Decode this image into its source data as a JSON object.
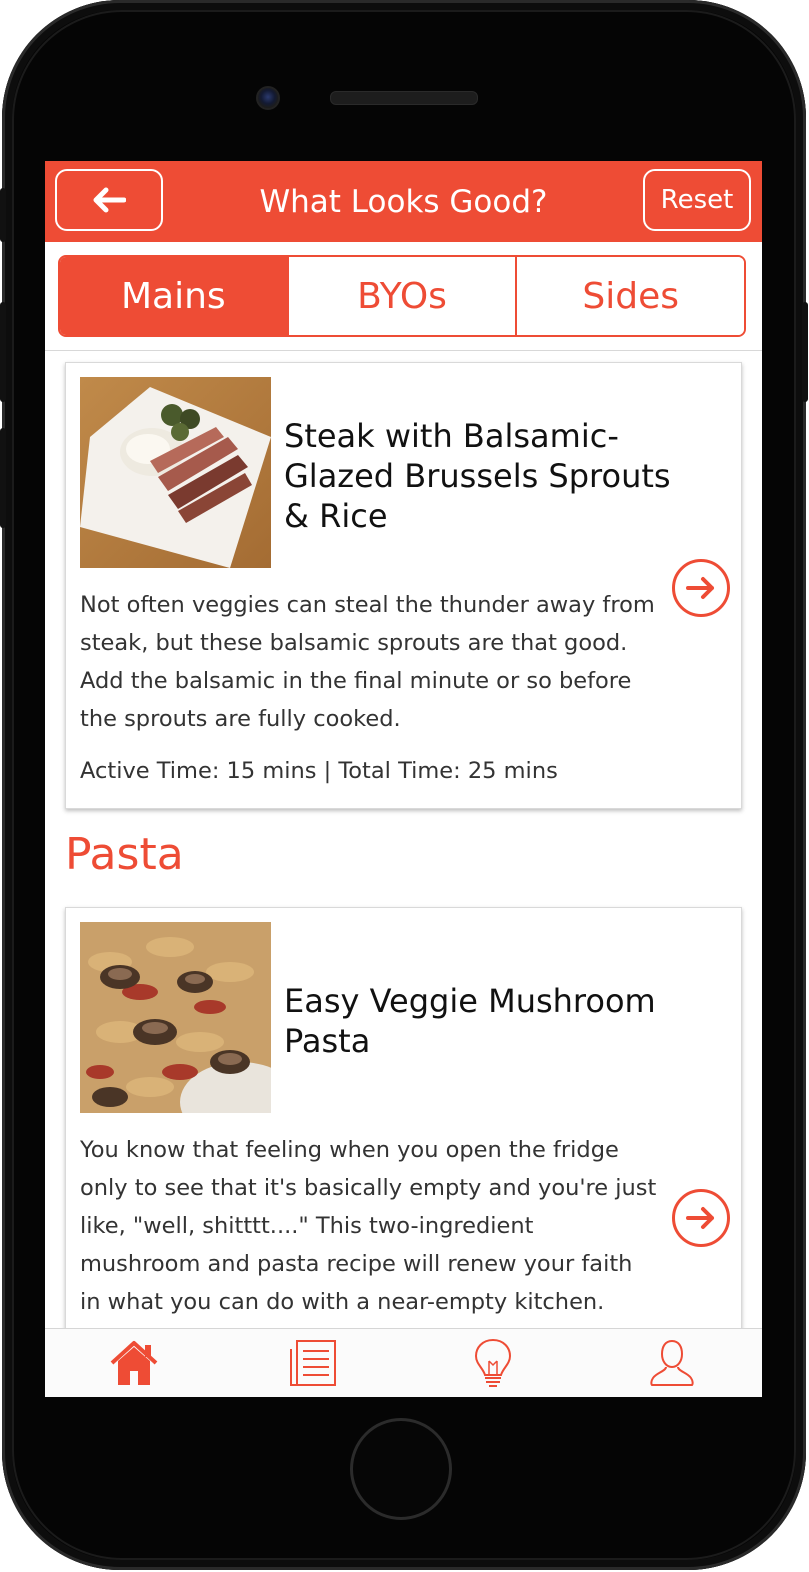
{
  "colors": {
    "accent": "#ee4c35",
    "header_text": "#ffffff",
    "body_text": "#333333"
  },
  "header": {
    "back_icon": "arrow-left-icon",
    "title": "What Looks Good?",
    "reset_label": "Reset"
  },
  "tabs": [
    {
      "label": "Mains",
      "active": true
    },
    {
      "label": "BYOs",
      "active": false
    },
    {
      "label": "Sides",
      "active": false
    }
  ],
  "recipes": [
    {
      "title": "Steak with Balsamic-Glazed Brussels Sprouts & Rice",
      "description": "Not often veggies can steal the thunder away from steak, but these balsamic sprouts are that good. Add the balsamic in the final minute or so before the sprouts are fully cooked.",
      "times": "Active Time: 15 mins | Total Time: 25 mins"
    },
    {
      "title": "Easy Veggie Mushroom Pasta",
      "description": "You know that feeling when you open the fridge only to see that it's basically empty and you're just like, \"well, shitttt....\" This two-ingredient mushroom and pasta recipe will renew your faith in what you can do with a near-empty kitchen."
    }
  ],
  "sections": {
    "pasta_title": "Pasta"
  },
  "tabbar": [
    {
      "icon": "home-icon",
      "active": true
    },
    {
      "icon": "recipe-list-icon",
      "active": false
    },
    {
      "icon": "lightbulb-icon",
      "active": false
    },
    {
      "icon": "profile-icon",
      "active": false
    }
  ]
}
